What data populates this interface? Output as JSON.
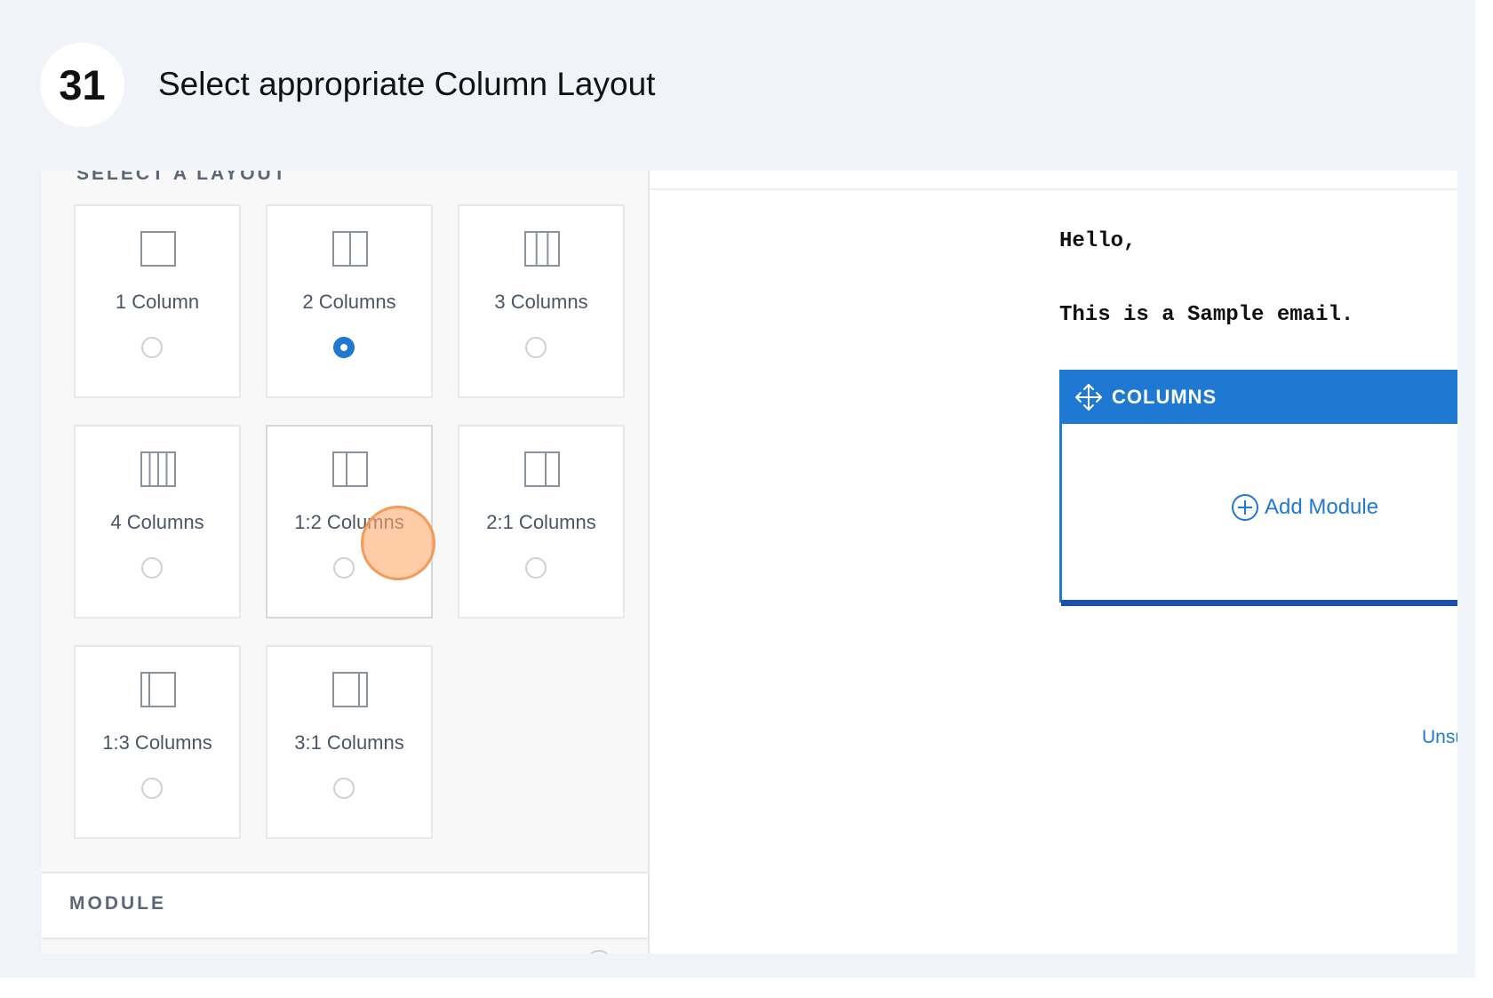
{
  "step": {
    "number": "31",
    "title": "Select appropriate Column Layout"
  },
  "layout_panel": {
    "heading": "SELECT A LAYOUT",
    "options": [
      {
        "label": "1 Column",
        "icon": "one-column-icon",
        "selected": false
      },
      {
        "label": "2 Columns",
        "icon": "two-columns-icon",
        "selected": true
      },
      {
        "label": "3 Columns",
        "icon": "three-columns-icon",
        "selected": false
      },
      {
        "label": "4 Columns",
        "icon": "four-columns-icon",
        "selected": false
      },
      {
        "label": "1:2 Columns",
        "icon": "one-two-columns-icon",
        "selected": false
      },
      {
        "label": "2:1 Columns",
        "icon": "two-one-columns-icon",
        "selected": false
      },
      {
        "label": "1:3 Columns",
        "icon": "one-three-columns-icon",
        "selected": false
      },
      {
        "label": "3:1 Columns",
        "icon": "three-one-columns-icon",
        "selected": false
      }
    ]
  },
  "module_section": {
    "heading": "MODULE"
  },
  "email_preview": {
    "greeting": "Hello,",
    "body": "This is a Sample email.",
    "columns_block": {
      "header": "COLUMNS",
      "add_module_label": "Add Module"
    },
    "unsubscribe_text": "Unsubsc"
  },
  "colors": {
    "accent": "#1f78d1",
    "click_marker": "#f59a56"
  }
}
